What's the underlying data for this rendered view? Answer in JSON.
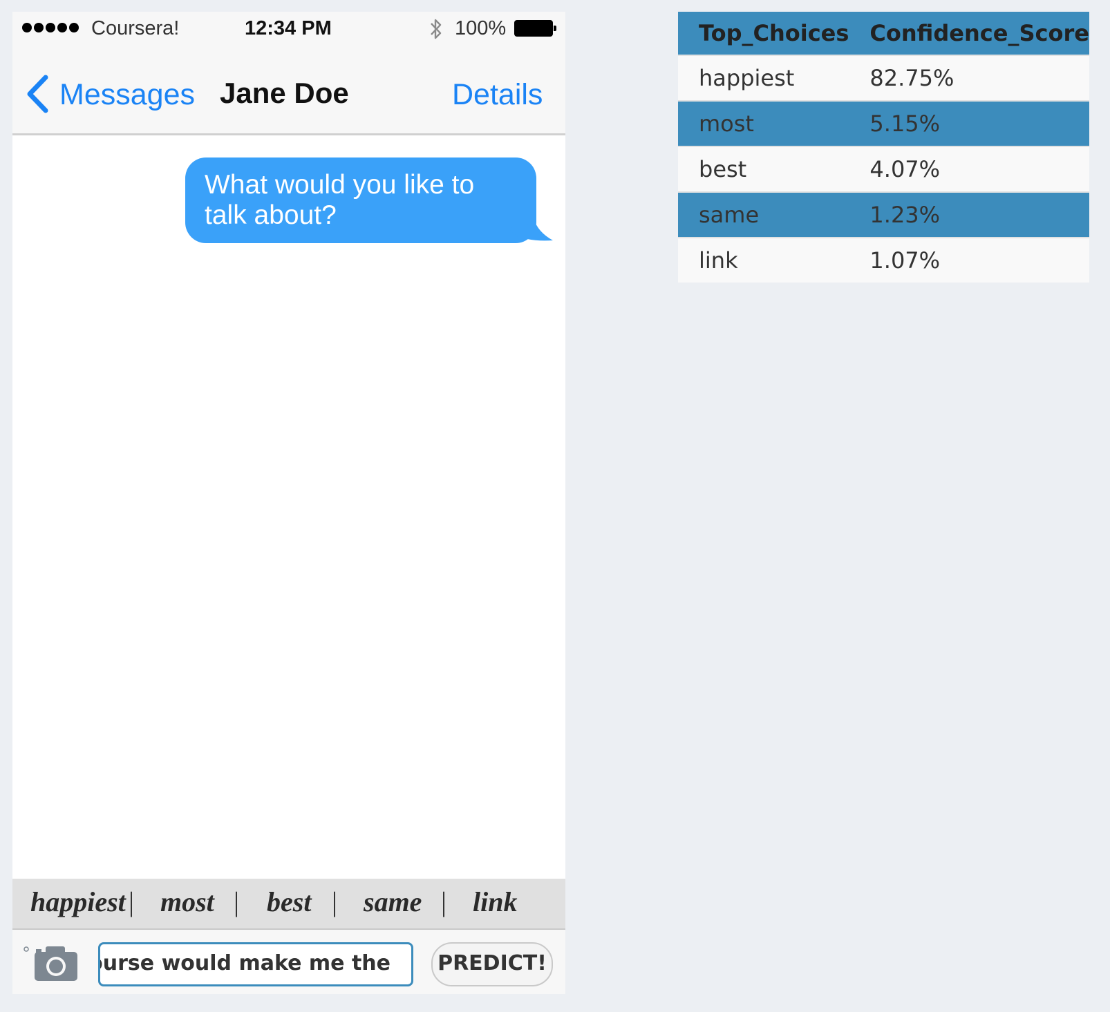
{
  "status_bar": {
    "carrier": "Coursera!",
    "time": "12:34 PM",
    "battery": "100%"
  },
  "nav": {
    "back_label": "Messages",
    "title": "Jane Doe",
    "details_label": "Details"
  },
  "message": {
    "line1": "What would you like to",
    "line2": "talk about?"
  },
  "suggestions": [
    "happiest",
    "most",
    "best",
    "same",
    "link"
  ],
  "suggestion_separator": "|",
  "input": {
    "value": "course would make me the"
  },
  "predict_button": "PREDICT!",
  "table": {
    "headers": [
      "Top_Choices",
      "Confidence_Score"
    ],
    "rows": [
      [
        "happiest",
        "82.75%"
      ],
      [
        "most",
        "5.15%"
      ],
      [
        "best",
        "4.07%"
      ],
      [
        "same",
        "1.23%"
      ],
      [
        "link",
        "1.07%"
      ]
    ]
  },
  "colors": {
    "ios_blue": "#1a83f5",
    "bubble_blue": "#3aa1f9",
    "table_accent": "#3c8cbc",
    "page_background": "#eceff3"
  }
}
